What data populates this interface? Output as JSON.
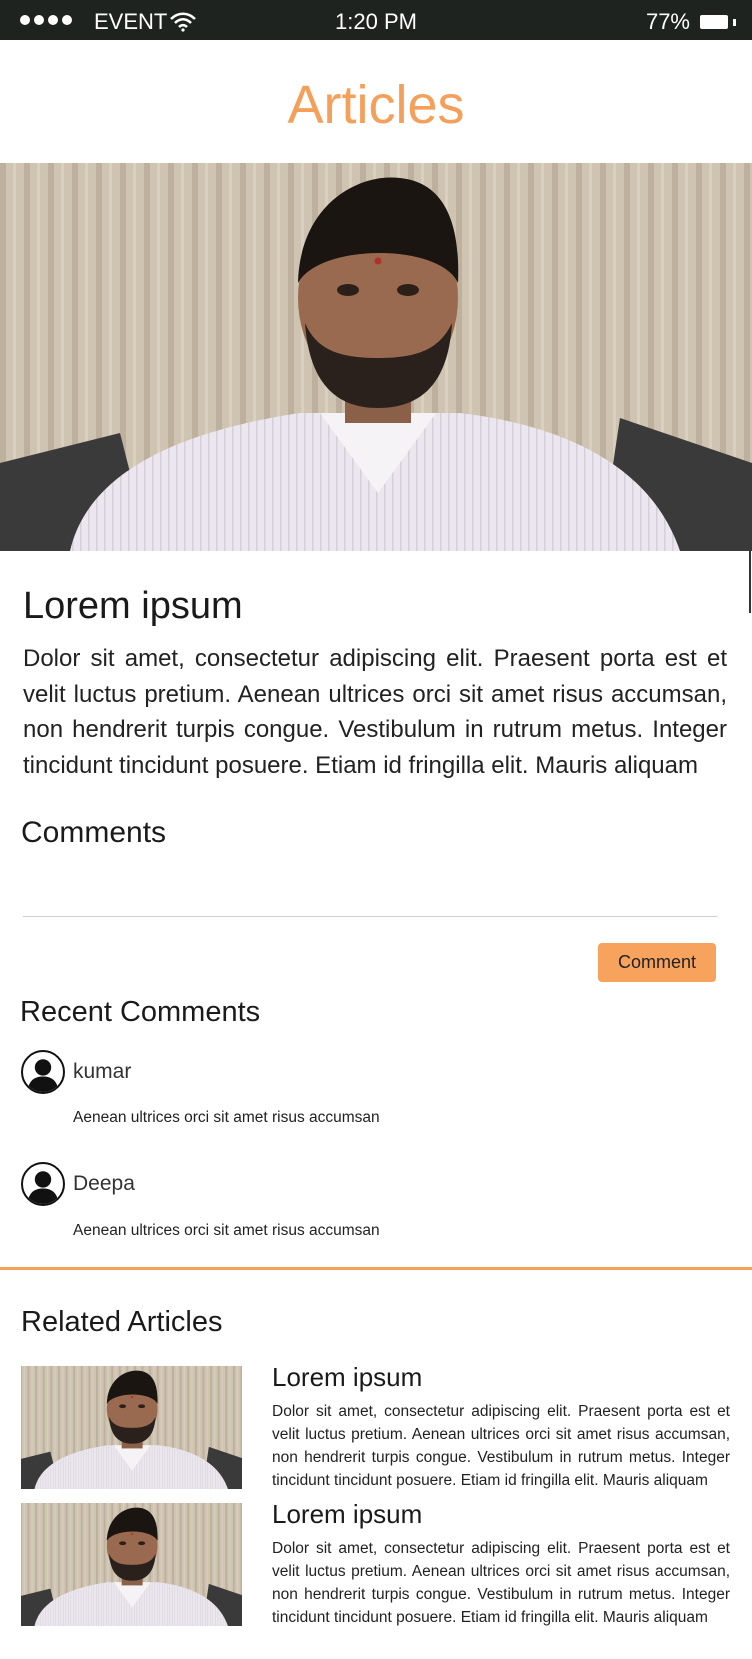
{
  "status_bar": {
    "carrier": "EVENT",
    "time": "1:20 PM",
    "battery": "77%"
  },
  "header": {
    "title": "Articles"
  },
  "colors": {
    "accent": "#f5a05a",
    "status_bar_bg": "#1e2320",
    "button_bg": "#f7a25d"
  },
  "article": {
    "title": "Lorem ipsum",
    "body": "Dolor sit amet, consectetur adipiscing elit. Praesent porta est et velit luctus pretium. Aenean ultrices orci sit amet risus accumsan, non hendrerit turpis congue. Vestibulum in rutrum metus. Integer tincidunt tincidunt posuere. Etiam id fringilla elit. Mauris aliquam"
  },
  "comments": {
    "label": "Comments",
    "input_placeholder": "",
    "button_label": "Comment"
  },
  "recent_comments": {
    "label": "Recent Comments",
    "items": [
      {
        "name": "kumar",
        "text": "Aenean ultrices orci sit amet risus accumsan"
      },
      {
        "name": "Deepa",
        "text": "Aenean ultrices orci sit amet risus accumsan"
      }
    ]
  },
  "related": {
    "label": "Related Articles",
    "items": [
      {
        "title": "Lorem ipsum",
        "body": "Dolor sit amet, consectetur adipiscing elit. Praesent porta est et velit luctus pretium. Aenean ultrices orci sit amet risus accumsan, non hendrerit turpis congue. Vestibulum in rutrum metus. Integer tincidunt tincidunt posuere. Etiam id fringilla elit. Mauris aliquam"
      },
      {
        "title": "Lorem ipsum",
        "body": "Dolor sit amet, consectetur adipiscing elit. Praesent porta est et velit luctus pretium. Aenean ultrices orci sit amet risus accumsan, non hendrerit turpis congue. Vestibulum in rutrum metus. Integer tincidunt tincidunt posuere. Etiam id fringilla elit. Mauris aliquam"
      }
    ]
  }
}
